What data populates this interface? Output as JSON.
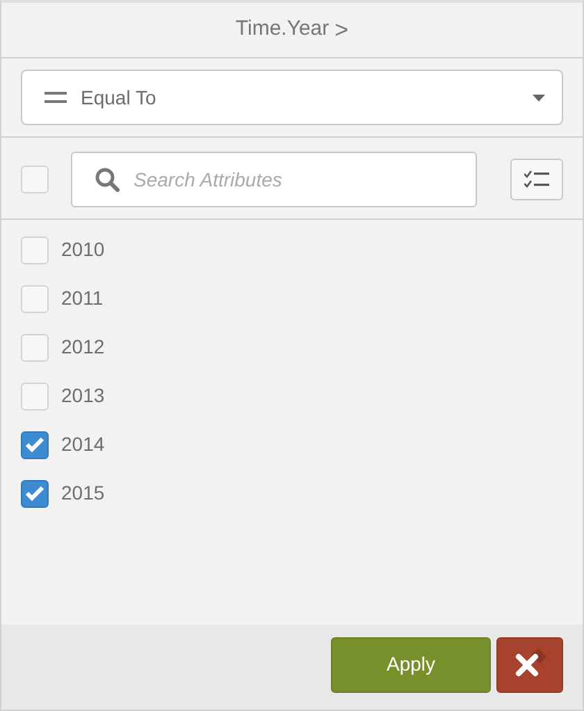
{
  "header": {
    "title": "Time.Year",
    "chevron": ">"
  },
  "operator": {
    "value": "Equal To"
  },
  "search": {
    "placeholder": "Search Attributes",
    "select_all_checked": false
  },
  "items": [
    {
      "label": "2010",
      "checked": false
    },
    {
      "label": "2011",
      "checked": false
    },
    {
      "label": "2012",
      "checked": false
    },
    {
      "label": "2013",
      "checked": false
    },
    {
      "label": "2014",
      "checked": true
    },
    {
      "label": "2015",
      "checked": true
    }
  ],
  "footer": {
    "apply": "Apply"
  }
}
